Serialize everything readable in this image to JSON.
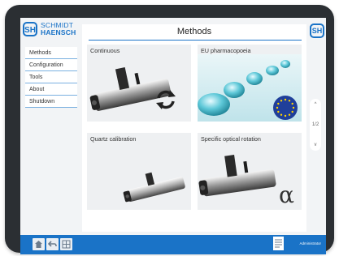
{
  "brand": {
    "mark": "SH",
    "line1": "SCHMIDT",
    "line2": "HAENSCH"
  },
  "sidebar": {
    "items": [
      {
        "label": "Methods"
      },
      {
        "label": "Configuration"
      },
      {
        "label": "Tools"
      },
      {
        "label": "About"
      },
      {
        "label": "Shutdown"
      }
    ]
  },
  "main": {
    "title": "Methods",
    "tiles": [
      {
        "label": "Continuous",
        "icon": "refresh-icon"
      },
      {
        "label": "EU pharmacopoeia",
        "icon": "eu-flag-icon"
      },
      {
        "label": "Quartz calibration",
        "icon": "quartz-tube-icon"
      },
      {
        "label": "Specific optical rotation",
        "icon": "alpha-icon"
      }
    ]
  },
  "scroller": {
    "up": "^",
    "page": "1/2",
    "down": "v"
  },
  "right_logo": "SH",
  "footer": {
    "buttons": [
      {
        "icon": "home-icon"
      },
      {
        "icon": "back-arrow-icon"
      },
      {
        "icon": "grid-icon"
      }
    ],
    "document_icon": "document-icon",
    "user": "Administrator"
  },
  "colors": {
    "accent": "#1a73c7",
    "frame": "#2b2f33",
    "tile": "#eef0f2"
  }
}
